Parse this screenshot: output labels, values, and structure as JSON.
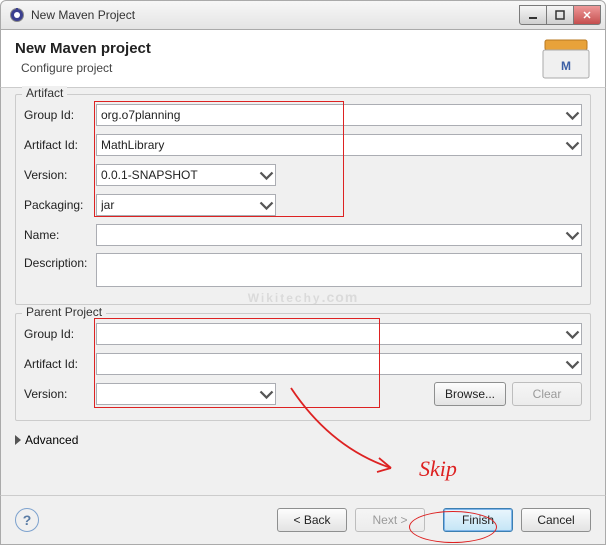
{
  "window": {
    "title": "New Maven Project"
  },
  "header": {
    "title": "New Maven project",
    "subtitle": "Configure project"
  },
  "artifact": {
    "legend": "Artifact",
    "groupId": {
      "label": "Group Id:",
      "value": "org.o7planning"
    },
    "artifactId": {
      "label": "Artifact Id:",
      "value": "MathLibrary"
    },
    "version": {
      "label": "Version:",
      "value": "0.0.1-SNAPSHOT"
    },
    "packaging": {
      "label": "Packaging:",
      "value": "jar"
    },
    "name": {
      "label": "Name:",
      "value": ""
    },
    "description": {
      "label": "Description:",
      "value": ""
    }
  },
  "parent": {
    "legend": "Parent Project",
    "groupId": {
      "label": "Group Id:",
      "value": ""
    },
    "artifactId": {
      "label": "Artifact Id:",
      "value": ""
    },
    "version": {
      "label": "Version:",
      "value": ""
    },
    "browse": "Browse...",
    "clear": "Clear"
  },
  "advanced": {
    "label": "Advanced"
  },
  "footer": {
    "back": "< Back",
    "next": "Next >",
    "finish": "Finish",
    "cancel": "Cancel"
  },
  "annotations": {
    "skip": "Skip"
  },
  "watermark": {
    "main": "Wikitechy",
    "sub": ".com"
  }
}
